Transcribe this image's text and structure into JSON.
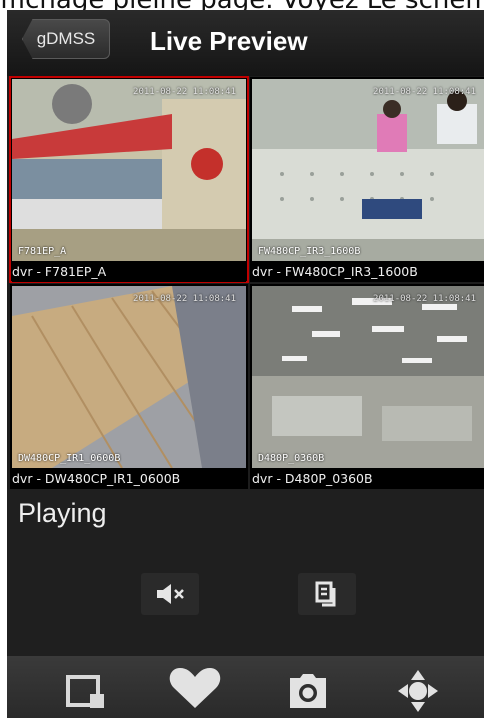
{
  "top_strip_text": "ffichage pleine page. Voyez Le schema",
  "header": {
    "back_label": "gDMSS",
    "title": "Live Preview"
  },
  "tiles": [
    {
      "caption": "dvr - F781EP_A",
      "overlay_name": "F781EP_A",
      "timestamp": "2011-08-22 11:08:41",
      "selected": true
    },
    {
      "caption": "dvr - FW480CP_IR3_1600B",
      "overlay_name": "FW480CP_IR3_1600B",
      "timestamp": "2011-08-22 11:08:41",
      "selected": false
    },
    {
      "caption": "dvr - DW480CP_IR1_0600B",
      "overlay_name": "DW480CP_IR1_0600B",
      "timestamp": "2011-08-22 11:08:41",
      "selected": false
    },
    {
      "caption": "dvr - D480P_0360B",
      "overlay_name": "D480P_0360B",
      "timestamp": "2011-08-22 11:08:41",
      "selected": false
    }
  ],
  "status": {
    "text": "Playing"
  },
  "controls": {
    "mute_icon": "speaker-muted-icon",
    "layout_icon": "screen-layout-icon"
  },
  "toolbar": {
    "icons": [
      "window-icon",
      "heart-icon",
      "camera-icon",
      "ptz-icon"
    ]
  },
  "colors": {
    "selected_border": "#c00000",
    "background": "#1d1d1d"
  }
}
